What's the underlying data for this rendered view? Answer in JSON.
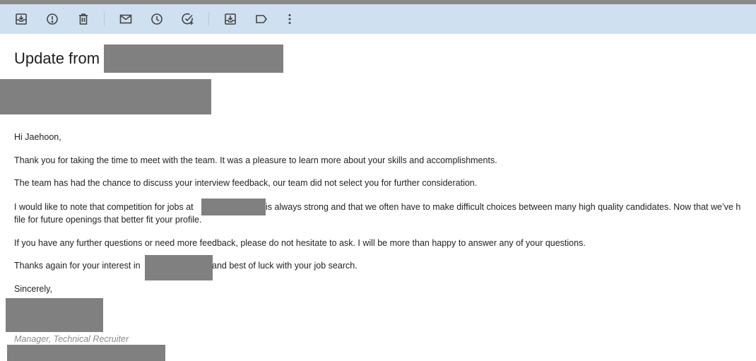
{
  "toolbar": {
    "icons": [
      {
        "name": "archive-icon"
      },
      {
        "name": "report-spam-icon"
      },
      {
        "name": "delete-icon"
      },
      {
        "name": "mark-unread-icon"
      },
      {
        "name": "snooze-icon"
      },
      {
        "name": "add-task-icon"
      },
      {
        "name": "move-to-icon"
      },
      {
        "name": "label-icon"
      },
      {
        "name": "more-options-icon"
      }
    ]
  },
  "email": {
    "subject_prefix": "Update from",
    "greeting": "Hi Jaehoon,",
    "p1": "Thank you for taking the time to meet with the team. It was a pleasure to learn more about your skills and accomplishments.",
    "p2": "The team has had the chance to discuss your interview feedback, our team did not select you for further consideration.",
    "p3_a": "I would like to note that competition for jobs at",
    "p3_b": "is always strong and that we often have to make difficult choices between many high quality candidates. Now that we’ve h",
    "p3_c": "file for future openings that better fit your profile.",
    "p4": "If you have any further questions or need more feedback, please do not hesitate to ask. I will be more than happy to answer any of your questions.",
    "p5_a": "Thanks again for your interest in",
    "p5_b": "and best of luck with your job search.",
    "closing": "Sincerely,",
    "signature_title": "Manager, Technical Recruiter"
  },
  "colors": {
    "toolbar_bg": "#cfe1f0",
    "redaction": "#808080"
  }
}
